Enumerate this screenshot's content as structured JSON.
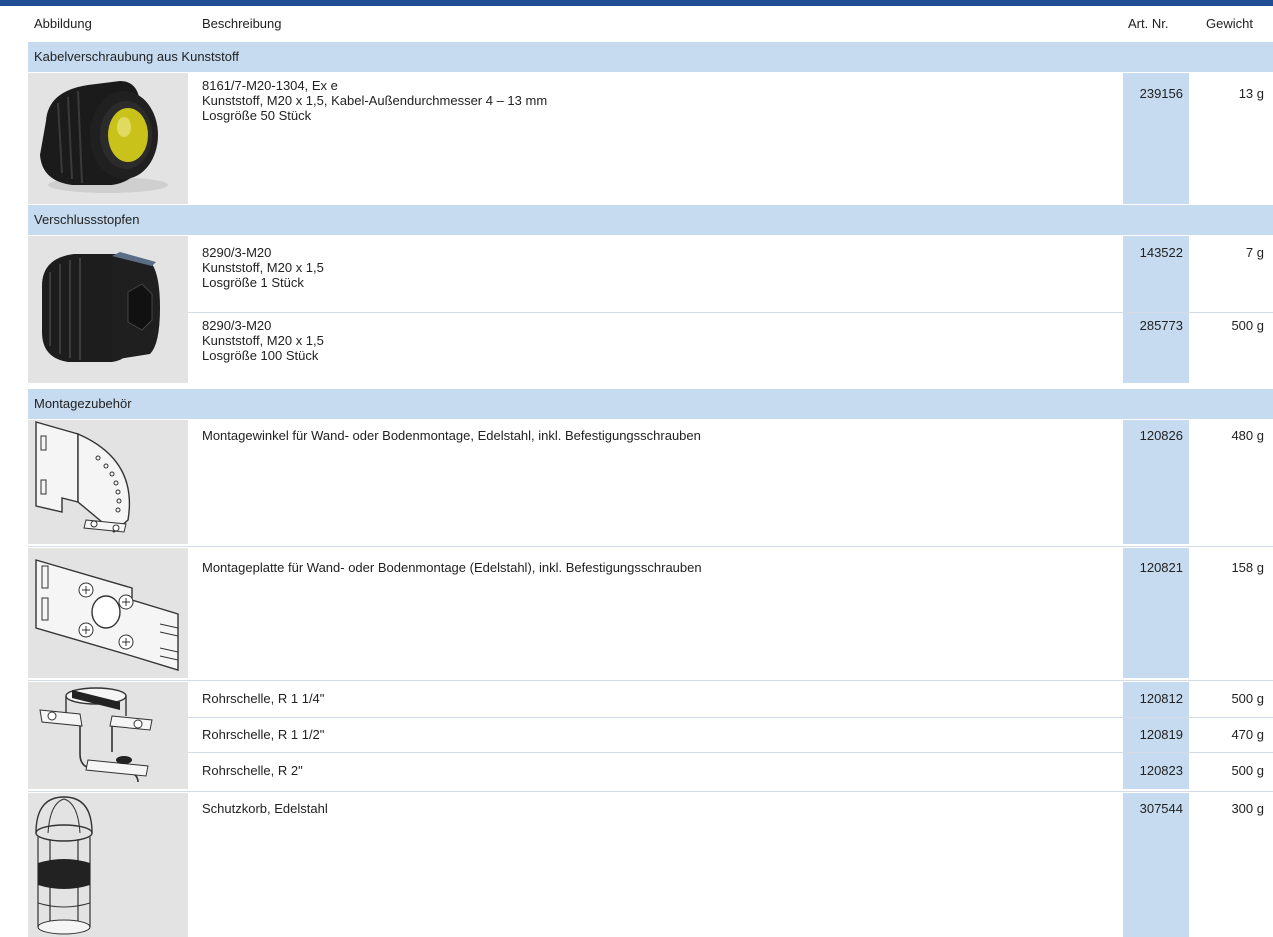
{
  "header": {
    "col_image": "Abbildung",
    "col_desc": "Beschreibung",
    "col_art": "Art. Nr.",
    "col_weight": "Gewicht"
  },
  "sections": [
    {
      "title": "Kabelverschraubung aus Kunststoff",
      "rows": [
        {
          "lines": [
            "8161/7-M20-1304, Ex e",
            "Kunststoff, M20 x 1,5, Kabel-Außendurchmesser 4 – 13 mm",
            "Losgröße 50 Stück"
          ],
          "art": "239156",
          "weight": "13 g"
        }
      ]
    },
    {
      "title": "Verschlussstopfen",
      "rows": [
        {
          "lines": [
            "8290/3-M20",
            "Kunststoff, M20 x 1,5",
            "Losgröße 1 Stück"
          ],
          "art": "143522",
          "weight": "7 g"
        },
        {
          "lines": [
            "8290/3-M20",
            "Kunststoff, M20 x 1,5",
            "Losgröße 100 Stück"
          ],
          "art": "285773",
          "weight": "500 g"
        }
      ]
    },
    {
      "title": "Montagezubehör",
      "rows": [
        {
          "lines": [
            "Montagewinkel für Wand- oder Bodenmontage, Edelstahl, inkl. Befestigungsschrauben"
          ],
          "art": "120826",
          "weight": "480 g"
        },
        {
          "lines": [
            "Montageplatte für Wand- oder Bodenmontage (Edelstahl), inkl. Befestigungsschrauben"
          ],
          "art": "120821",
          "weight": "158 g"
        },
        {
          "lines": [
            "Rohrschelle, R 1 1/4\""
          ],
          "art": "120812",
          "weight": "500 g"
        },
        {
          "lines": [
            "Rohrschelle, R 1 1/2\""
          ],
          "art": "120819",
          "weight": "470 g"
        },
        {
          "lines": [
            "Rohrschelle, R 2\""
          ],
          "art": "120823",
          "weight": "500 g"
        },
        {
          "lines": [
            "Schutzkorb, Edelstahl"
          ],
          "art": "307544",
          "weight": "300 g"
        }
      ]
    }
  ],
  "colors": {
    "top_bar": "#1f4e93",
    "section_bg": "#c6dbef",
    "art_column_bg": "#c6dbef",
    "image_bg": "#e3e3e3"
  },
  "icons": [
    "cable-gland-image",
    "sealing-plug-image",
    "mounting-bracket-image",
    "mounting-plate-image",
    "pipe-clamp-image",
    "protective-basket-image"
  ]
}
